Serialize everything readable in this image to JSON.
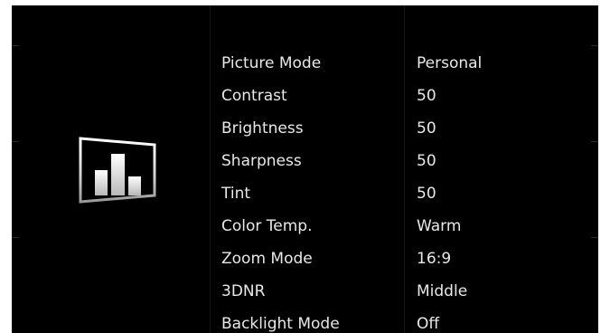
{
  "menu": {
    "icon": "picture-settings-icon",
    "items": [
      {
        "label": "Picture Mode",
        "value": "Personal"
      },
      {
        "label": "Contrast",
        "value": "50"
      },
      {
        "label": "Brightness",
        "value": "50"
      },
      {
        "label": "Sharpness",
        "value": "50"
      },
      {
        "label": "Tint",
        "value": "50"
      },
      {
        "label": "Color Temp.",
        "value": "Warm"
      },
      {
        "label": "Zoom Mode",
        "value": "16:9"
      },
      {
        "label": "3DNR",
        "value": "Middle"
      },
      {
        "label": "Backlight Mode",
        "value": "Off"
      }
    ]
  },
  "colors": {
    "background": "#000000",
    "text": "#e8e8e8",
    "frame": "#ffffff"
  }
}
